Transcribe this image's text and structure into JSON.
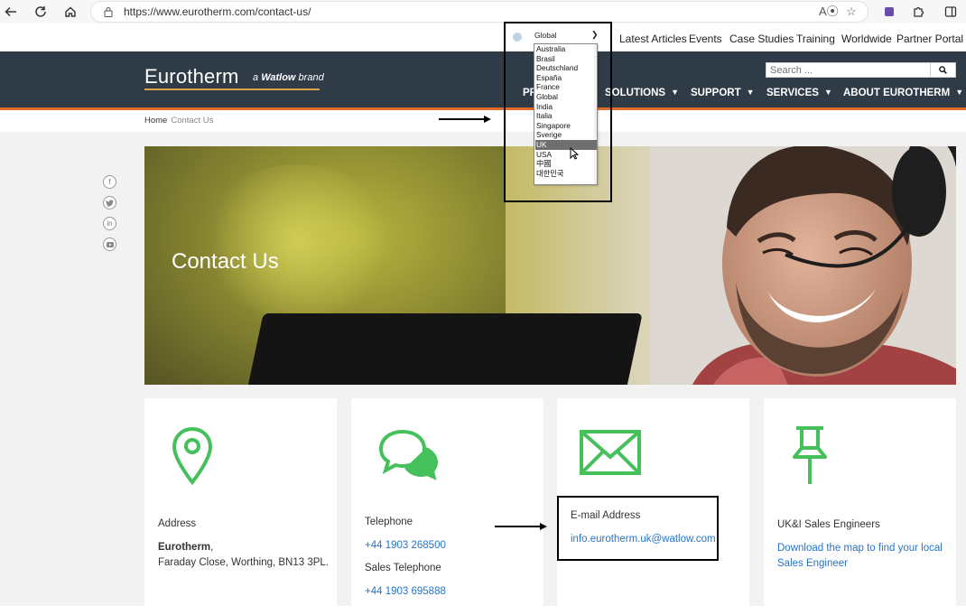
{
  "browser": {
    "url": "https://www.eurotherm.com/contact-us/"
  },
  "utility_nav": {
    "region_selected": "Global",
    "links": [
      "Latest Articles",
      "Events",
      "Case Studies",
      "Training",
      "Worldwide",
      "Partner Portal"
    ]
  },
  "region_dropdown": {
    "options": [
      "Australia",
      "Brasil",
      "Deutschland",
      "España",
      "France",
      "Global",
      "India",
      "Italia",
      "Singapore",
      "Sverige",
      "UK",
      "USA",
      "中國",
      "대한민국"
    ],
    "highlighted": "UK"
  },
  "header": {
    "logo": "Eurotherm",
    "logo_sub_prefix": "a",
    "logo_sub_brand": "Watlow",
    "logo_sub_suffix": "brand",
    "search_placeholder": "Search ...",
    "nav": [
      "PR",
      "SOLUTIONS",
      "SUPPORT",
      "SERVICES",
      "ABOUT EUROTHERM"
    ]
  },
  "breadcrumb": {
    "home": "Home",
    "current": "Contact Us"
  },
  "hero": {
    "title": "Contact Us"
  },
  "social_icons": [
    "facebook-icon",
    "twitter-icon",
    "linkedin-icon",
    "youtube-icon"
  ],
  "cards": {
    "address": {
      "label": "Address",
      "company": "Eurotherm",
      "comma": ",",
      "line": "Faraday Close, Worthing, BN13 3PL."
    },
    "telephone": {
      "label": "Telephone",
      "phone": "+44 1903 268500",
      "sales_label": "Sales Telephone",
      "sales_phone": "+44 1903 695888"
    },
    "email": {
      "label": "E-mail Address",
      "email": "info.eurotherm.uk@watlow.com"
    },
    "sales_engineers": {
      "label": "UK&I Sales Engineers",
      "link_line1": "Download the map to find your local",
      "link_line2": "Sales Engineer"
    }
  },
  "colors": {
    "header_bg": "#2f3b46",
    "accent_orange": "#e06a2a",
    "icon_green": "#45c05a",
    "link_blue": "#2774c9"
  }
}
